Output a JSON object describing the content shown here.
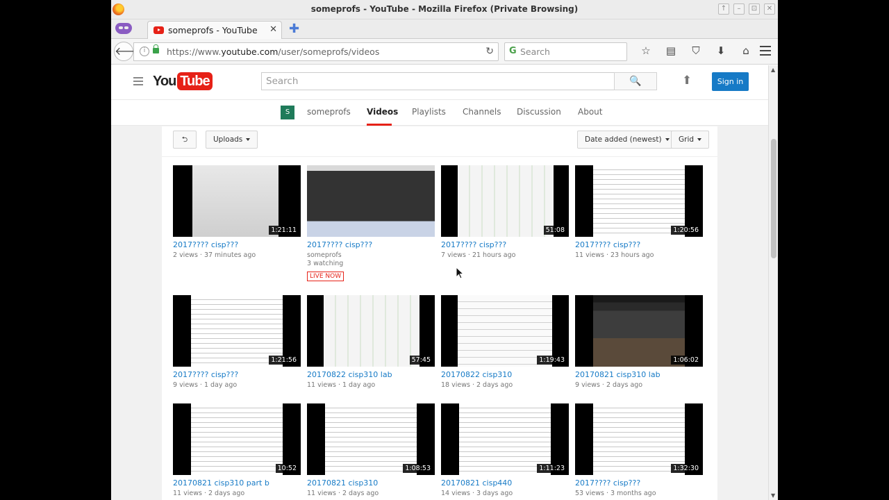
{
  "window": {
    "title": "someprofs - YouTube - Mozilla Firefox (Private Browsing)",
    "controls": [
      "↑",
      "–",
      "⊡",
      "✕"
    ]
  },
  "tabbar": {
    "tab_title": "someprofs - YouTube",
    "close": "✕",
    "new_tab": "✚"
  },
  "navbar": {
    "back": "🡐",
    "info": "i",
    "url_prefix": "https://www.",
    "url_host": "youtube.com",
    "url_path": "/user/someprofs/videos",
    "reload": "↻",
    "search_placeholder": "Search",
    "search_engine_icon": "G",
    "toolbar_icons": [
      "☆",
      "▤",
      "⛉",
      "⬇",
      "⌂"
    ]
  },
  "youtube": {
    "logo_you": "You",
    "logo_tube": "Tube",
    "search_placeholder": "Search",
    "search_icon": "🔍",
    "upload_icon": "⬆",
    "sign_in": "Sign in"
  },
  "channel": {
    "avatar_letter": "S",
    "tabs": [
      "someprofs",
      "Videos",
      "Playlists",
      "Channels",
      "Discussion",
      "About"
    ],
    "active_tab": "Videos"
  },
  "toolbar": {
    "back_icon": "⮌",
    "uploads": "Uploads",
    "sort": "Date added (newest)",
    "view": "Grid"
  },
  "videos": [
    {
      "title": "2017???? cisp???",
      "meta1": "2 views · 37 minutes ago",
      "meta2": "",
      "meta3": "",
      "live": "",
      "duration": "1:21:11",
      "thumb_style": "paper"
    },
    {
      "title": "2017???? cisp???",
      "meta1": "someprofs",
      "meta2": "3 watching",
      "meta3": "",
      "live": "LIVE NOW",
      "duration": "",
      "thumb_style": "desktop"
    },
    {
      "title": "2017???? cisp???",
      "meta1": "7 views · 21 hours ago",
      "meta2": "",
      "meta3": "",
      "live": "",
      "duration": "51:08",
      "thumb_style": "circuit"
    },
    {
      "title": "2017???? cisp???",
      "meta1": "11 views · 23 hours ago",
      "meta2": "",
      "meta3": "",
      "live": "",
      "duration": "1:20:56",
      "thumb_style": "doc"
    },
    {
      "title": "2017???? cisp???",
      "meta1": "9 views · 1 day ago",
      "meta2": "",
      "meta3": "",
      "live": "",
      "duration": "1:21:56",
      "thumb_style": "doc"
    },
    {
      "title": "20170822 cisp310 lab",
      "meta1": "11 views · 1 day ago",
      "meta2": "",
      "meta3": "",
      "live": "",
      "duration": "57:45",
      "thumb_style": "circuit"
    },
    {
      "title": "20170822 cisp310",
      "meta1": "18 views · 2 days ago",
      "meta2": "",
      "meta3": "",
      "live": "",
      "duration": "1:19:43",
      "thumb_style": "diagram"
    },
    {
      "title": "20170821 cisp310 lab",
      "meta1": "9 views · 2 days ago",
      "meta2": "",
      "meta3": "",
      "live": "",
      "duration": "1:06:02",
      "thumb_style": "web"
    },
    {
      "title": "20170821 cisp310 part b",
      "meta1": "11 views · 2 days ago",
      "meta2": "",
      "meta3": "",
      "live": "",
      "duration": "10:52",
      "thumb_style": "doc"
    },
    {
      "title": "20170821 cisp310",
      "meta1": "11 views · 2 days ago",
      "meta2": "",
      "meta3": "",
      "live": "",
      "duration": "1:08:53",
      "thumb_style": "doc"
    },
    {
      "title": "20170821 cisp440",
      "meta1": "14 views · 3 days ago",
      "meta2": "",
      "meta3": "",
      "live": "",
      "duration": "1:11:23",
      "thumb_style": "doc"
    },
    {
      "title": "2017???? cisp???",
      "meta1": "53 views · 3 months ago",
      "meta2": "",
      "meta3": "",
      "live": "",
      "duration": "1:32:30",
      "thumb_style": "doc"
    }
  ],
  "colors": {
    "youtube_red": "#e62117",
    "link_blue": "#167ac6",
    "signin_blue": "#167ac6"
  }
}
